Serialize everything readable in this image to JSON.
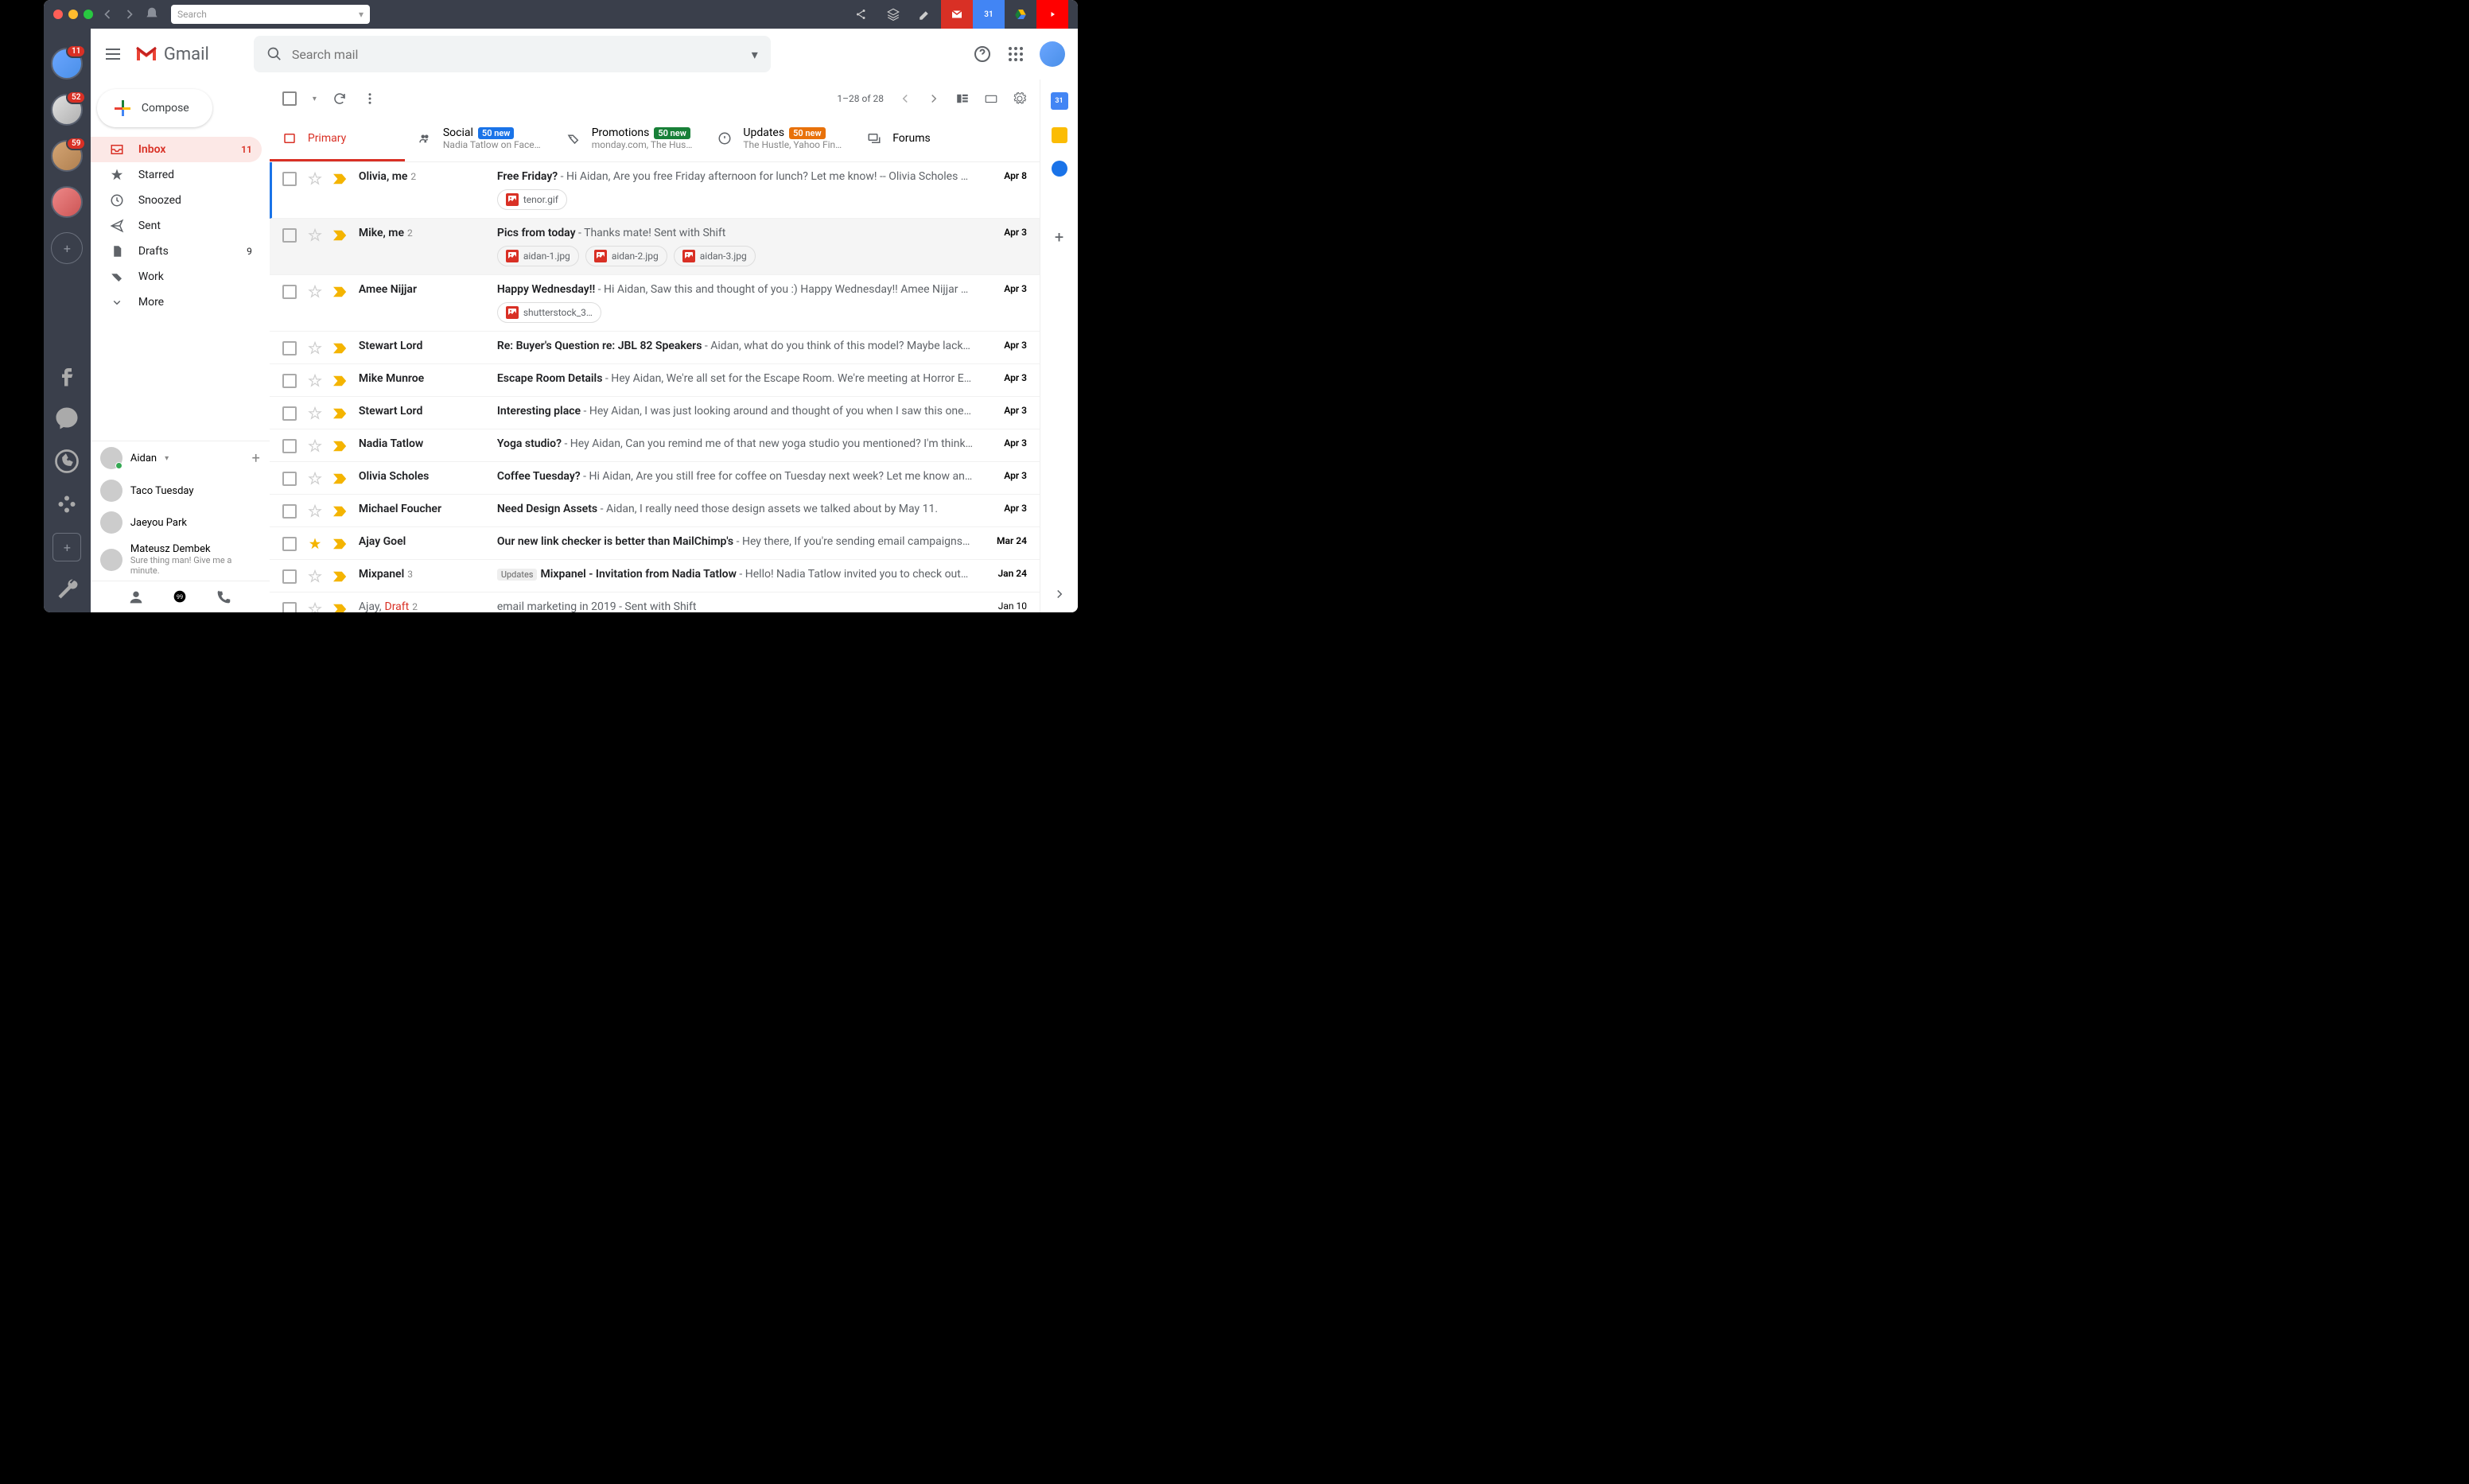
{
  "titlebar": {
    "search_placeholder": "Search"
  },
  "leftbar": {
    "badges": [
      "11",
      "52",
      "59"
    ]
  },
  "header": {
    "logo": "Gmail",
    "search_placeholder": "Search mail"
  },
  "compose_label": "Compose",
  "folders": [
    {
      "icon": "inbox",
      "label": "Inbox",
      "count": "11",
      "active": true
    },
    {
      "icon": "star",
      "label": "Starred"
    },
    {
      "icon": "clock",
      "label": "Snoozed"
    },
    {
      "icon": "send",
      "label": "Sent"
    },
    {
      "icon": "file",
      "label": "Drafts",
      "count": "9"
    },
    {
      "icon": "tag",
      "label": "Work"
    },
    {
      "icon": "chev",
      "label": "More"
    }
  ],
  "hangouts": {
    "user": "Aidan",
    "contacts": [
      {
        "name": "Taco Tuesday"
      },
      {
        "name": "Jaeyou Park"
      },
      {
        "name": "Mateusz Dembek",
        "sub": "Sure thing man! Give me a minute."
      }
    ]
  },
  "toolbar": {
    "pager": "1–28 of 28"
  },
  "tabs": [
    {
      "key": "primary",
      "label": "Primary",
      "active": true
    },
    {
      "key": "social",
      "label": "Social",
      "badge": "50 new",
      "badge_color": "blue",
      "sub": "Nadia Tatlow on Face…"
    },
    {
      "key": "promotions",
      "label": "Promotions",
      "badge": "50 new",
      "badge_color": "green",
      "sub": "monday.com, The Hus…"
    },
    {
      "key": "updates",
      "label": "Updates",
      "badge": "50 new",
      "badge_color": "orange",
      "sub": "The Hustle, Yahoo Fin…"
    },
    {
      "key": "forums",
      "label": "Forums"
    }
  ],
  "mails": [
    {
      "sender": "Olivia, me",
      "ct": "2",
      "subj": "Free Friday?",
      "prev": " - Hi Aidan, Are you free Friday afternoon for lunch? Let me know! -- Olivia Scholes …",
      "date": "Apr 8",
      "selected": true,
      "attachments": [
        "tenor.gif"
      ]
    },
    {
      "sender": "Mike, me",
      "ct": "2",
      "subj": "Pics from today",
      "prev": " - Thanks mate! Sent with Shift",
      "date": "Apr 3",
      "hover": true,
      "attachments": [
        "aidan-1.jpg",
        "aidan-2.jpg",
        "aidan-3.jpg"
      ]
    },
    {
      "sender": "Amee Nijjar",
      "subj": "Happy Wednesday!!",
      "prev": " - Hi Aidan, Saw this and thought of you :) Happy Wednesday!! Amee Nijjar …",
      "date": "Apr 3",
      "attachments": [
        "shutterstock_3…"
      ]
    },
    {
      "sender": "Stewart Lord",
      "subj": "Re: Buyer's Question re: JBL 82 Speakers",
      "prev": " - Aidan, what do you think of this model? Maybe lack…",
      "date": "Apr 3"
    },
    {
      "sender": "Mike Munroe",
      "subj": "Escape Room Details",
      "prev": " - Hey Aidan, We're all set for the Escape Room. We're meeting at Horror E…",
      "date": "Apr 3"
    },
    {
      "sender": "Stewart Lord",
      "subj": "Interesting place",
      "prev": " - Hey Aidan, I was just looking around and thought of you when I saw this one…",
      "date": "Apr 3"
    },
    {
      "sender": "Nadia Tatlow",
      "subj": "Yoga studio?",
      "prev": " - Hey Aidan, Can you remind me of that new yoga studio you mentioned? I'm think…",
      "date": "Apr 3"
    },
    {
      "sender": "Olivia Scholes",
      "subj": "Coffee Tuesday?",
      "prev": " - Hi Aidan, Are you still free for coffee on Tuesday next week? Let me know an…",
      "date": "Apr 3"
    },
    {
      "sender": "Michael Foucher",
      "subj": "Need Design Assets",
      "prev": " - Aidan, I really need those design assets we talked about by May 11.",
      "date": "Apr 3"
    },
    {
      "sender": "Ajay Goel",
      "subj": "Our new link checker is better than MailChimp's",
      "prev": " - Hey there, If you're sending email campaigns…",
      "date": "Mar 24",
      "starred": true
    },
    {
      "sender": "Mixpanel",
      "ct": "3",
      "lbl": "Updates",
      "subj": "Mixpanel - Invitation from Nadia Tatlow",
      "prev": " - Hello! Nadia Tatlow invited you to check out…",
      "date": "Jan 24"
    },
    {
      "sender": "Ajay, ",
      "draft": "Draft",
      "ct": "2",
      "subj": "email marketing in 2019",
      "prev": " - Sent with Shift",
      "date": "Jan 10",
      "read": true
    }
  ],
  "rightbar": {
    "cal": "31"
  }
}
